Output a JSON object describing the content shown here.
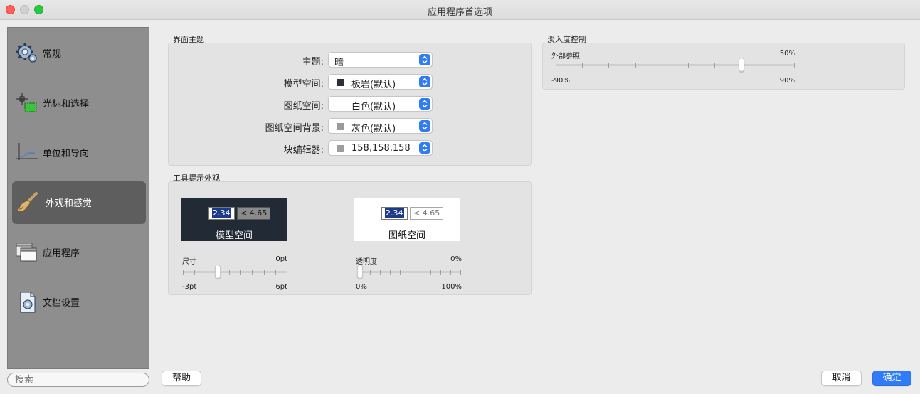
{
  "window": {
    "title": "应用程序首选项"
  },
  "sidebar": {
    "items": [
      {
        "label": "常规",
        "icon": "gear-icon"
      },
      {
        "label": "光标和选择",
        "icon": "cursor-selection-icon"
      },
      {
        "label": "单位和导向",
        "icon": "units-axis-icon"
      },
      {
        "label": "外观和感觉",
        "icon": "paintbrush-icon",
        "selected": true
      },
      {
        "label": "应用程序",
        "icon": "app-windows-icon"
      },
      {
        "label": "文档设置",
        "icon": "document-settings-icon"
      }
    ],
    "search_placeholder": "搜索"
  },
  "theme": {
    "section_title": "界面主题",
    "rows": [
      {
        "label": "主题:",
        "value": "暗",
        "swatch": ""
      },
      {
        "label": "模型空间:",
        "value": "板岩(默认)",
        "swatch": "#2b2f36"
      },
      {
        "label": "图纸空间:",
        "value": "白色(默认)",
        "swatch": "#ffffff"
      },
      {
        "label": "图纸空间背景:",
        "value": "灰色(默认)",
        "swatch": "#9a9a9a"
      },
      {
        "label": "块编辑器:",
        "value": "158,158,158",
        "swatch": "#9e9e9e"
      }
    ]
  },
  "tooltip": {
    "section_title": "工具提示外观",
    "model_preview": {
      "value_a": "2.34",
      "value_b": "< 4.65",
      "label": "模型空间"
    },
    "paper_preview": {
      "value_a": "2.34",
      "value_b": "< 4.65",
      "label": "图纸空间"
    },
    "size_slider": {
      "caption": "尺寸",
      "current": "0pt",
      "min_label": "-3pt",
      "max_label": "6pt",
      "value": 0,
      "min": -3,
      "max": 6
    },
    "opacity_slider": {
      "caption": "透明度",
      "current": "0%",
      "min_label": "0%",
      "max_label": "100%",
      "value": 0,
      "min": 0,
      "max": 100
    }
  },
  "fade": {
    "section_title": "淡入度控制",
    "xref_slider": {
      "caption": "外部参照",
      "current": "50%",
      "min_label": "-90%",
      "max_label": "90%",
      "value": 50,
      "min": -90,
      "max": 90
    }
  },
  "buttons": {
    "help": "帮助",
    "cancel": "取消",
    "ok": "确定"
  },
  "colors": {
    "accent": "#2f7cf6",
    "sidebar_bg": "#8e8e8e",
    "sidebar_selected": "#5e5e5e"
  }
}
